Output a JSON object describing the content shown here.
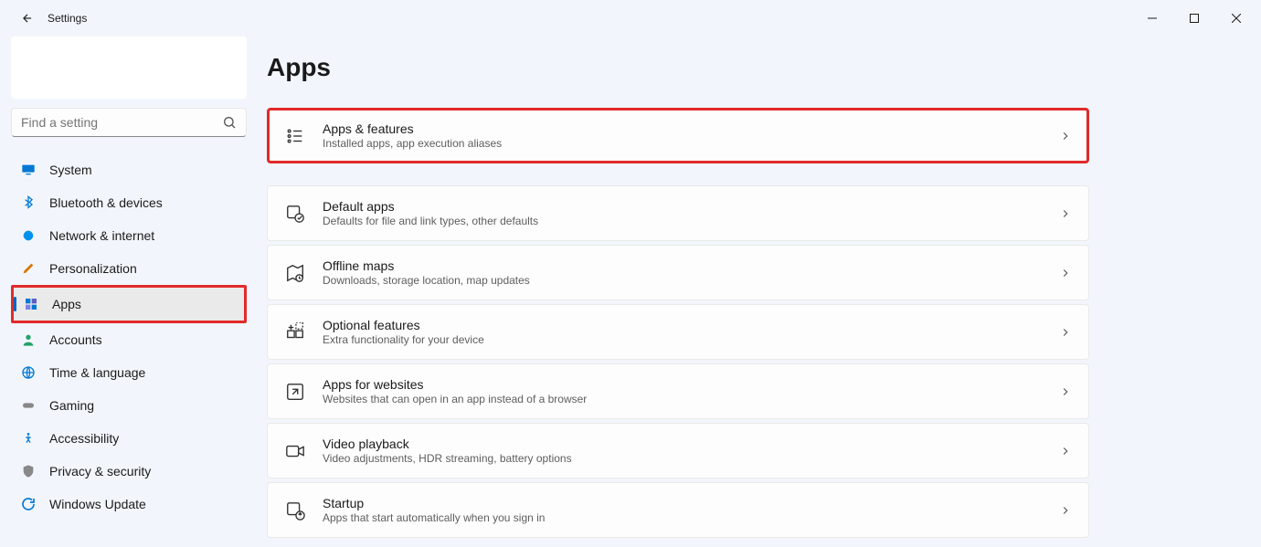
{
  "titlebar": {
    "title": "Settings"
  },
  "search": {
    "placeholder": "Find a setting"
  },
  "nav": {
    "items": [
      {
        "label": "System"
      },
      {
        "label": "Bluetooth & devices"
      },
      {
        "label": "Network & internet"
      },
      {
        "label": "Personalization"
      },
      {
        "label": "Apps"
      },
      {
        "label": "Accounts"
      },
      {
        "label": "Time & language"
      },
      {
        "label": "Gaming"
      },
      {
        "label": "Accessibility"
      },
      {
        "label": "Privacy & security"
      },
      {
        "label": "Windows Update"
      }
    ]
  },
  "page": {
    "title": "Apps"
  },
  "cards": [
    {
      "title": "Apps & features",
      "subtitle": "Installed apps, app execution aliases"
    },
    {
      "title": "Default apps",
      "subtitle": "Defaults for file and link types, other defaults"
    },
    {
      "title": "Offline maps",
      "subtitle": "Downloads, storage location, map updates"
    },
    {
      "title": "Optional features",
      "subtitle": "Extra functionality for your device"
    },
    {
      "title": "Apps for websites",
      "subtitle": "Websites that can open in an app instead of a browser"
    },
    {
      "title": "Video playback",
      "subtitle": "Video adjustments, HDR streaming, battery options"
    },
    {
      "title": "Startup",
      "subtitle": "Apps that start automatically when you sign in"
    }
  ]
}
